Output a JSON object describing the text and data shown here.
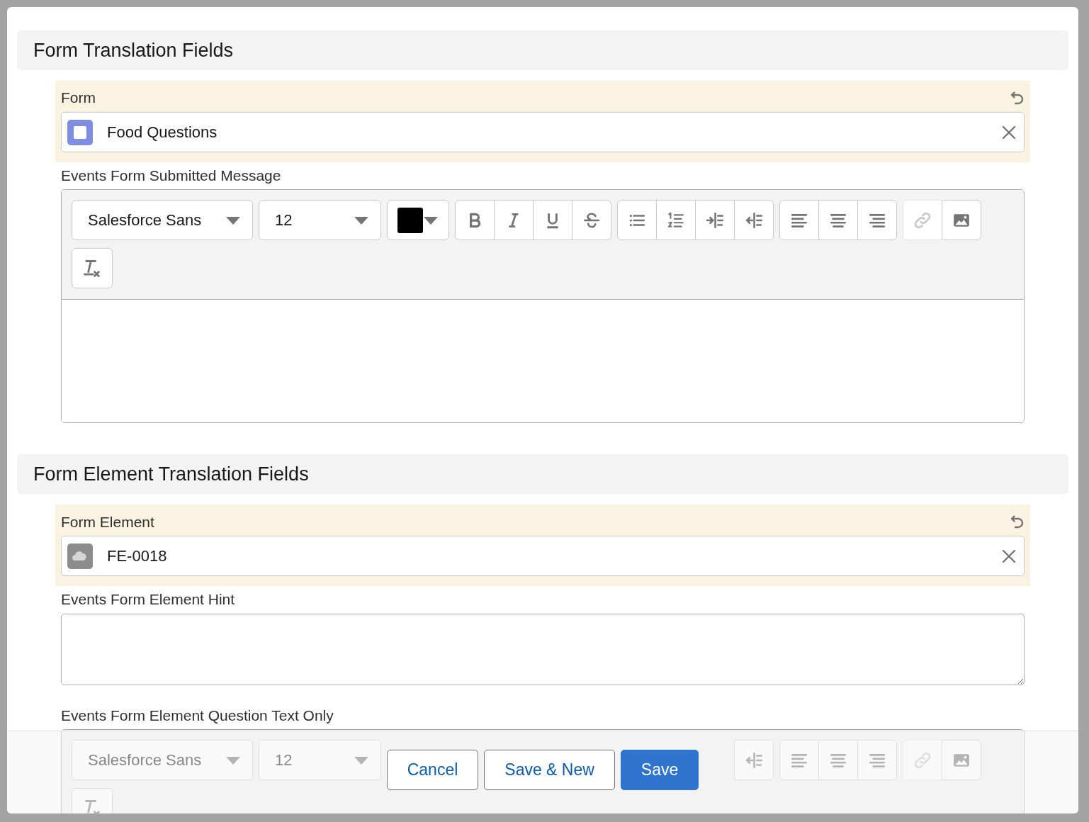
{
  "sections": [
    {
      "title": "Form Translation Fields",
      "fields": [
        {
          "kind": "lookup",
          "label": "Form",
          "value": "Food Questions",
          "changed": true
        },
        {
          "kind": "rich_text",
          "label": "Events Form Submitted Message",
          "font": "Salesforce Sans",
          "size": "12",
          "link_disabled": true
        }
      ]
    },
    {
      "title": "Form Element Translation Fields",
      "fields": [
        {
          "kind": "lookup",
          "label": "Form Element",
          "value": "FE-0018",
          "changed": true
        },
        {
          "kind": "textarea",
          "label": "Events Form Element Hint"
        },
        {
          "kind": "rich_text",
          "label": "Events Form Element Question Text Only",
          "font": "Salesforce Sans",
          "size": "12",
          "link_disabled": true
        }
      ]
    }
  ],
  "footer": {
    "buttons": [
      {
        "label": "Cancel",
        "kind": "neutral"
      },
      {
        "label": "Save & New",
        "kind": "neutral"
      },
      {
        "label": "Save",
        "kind": "brand"
      }
    ]
  }
}
